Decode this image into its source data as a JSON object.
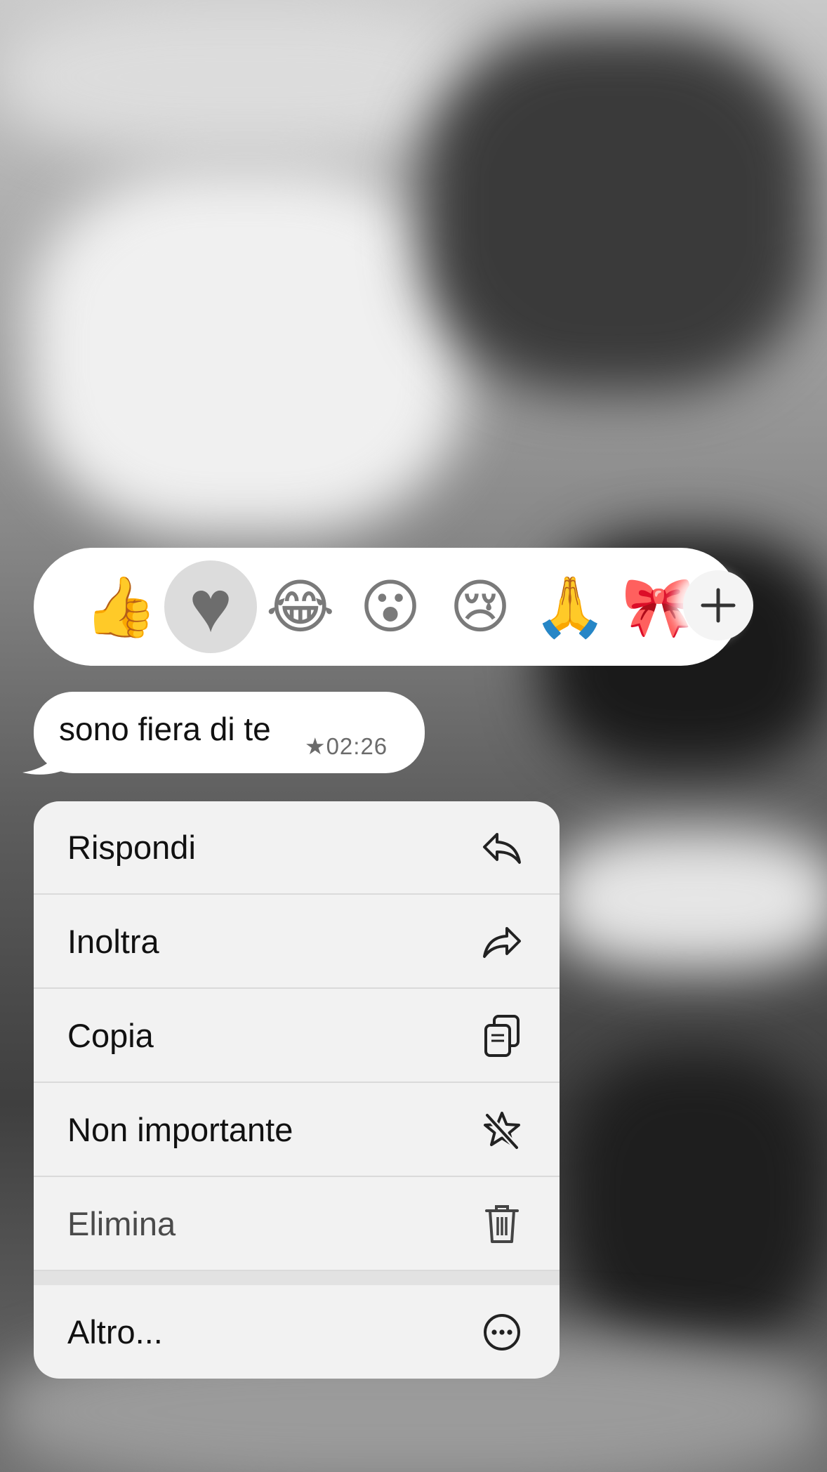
{
  "reaction_bar": {
    "reactions": [
      {
        "icon": "thumbs-up-emoji",
        "glyph": "👍"
      },
      {
        "icon": "heart-emoji",
        "glyph": "♥",
        "selected": true
      },
      {
        "icon": "tears-of-joy-emoji",
        "glyph": "😂"
      },
      {
        "icon": "surprised-face-emoji",
        "glyph": "😮"
      },
      {
        "icon": "crying-face-emoji",
        "glyph": "😢"
      },
      {
        "icon": "folded-hands-emoji",
        "glyph": "🙏"
      },
      {
        "icon": "ribbon-emoji",
        "glyph": "🎀"
      }
    ],
    "more_icon": "plus-icon"
  },
  "message": {
    "text": "sono fiera di te",
    "starred_icon": "star-icon",
    "time": "★02:26"
  },
  "context_menu": {
    "items": [
      {
        "label": "Rispondi",
        "icon": "reply-icon"
      },
      {
        "label": "Inoltra",
        "icon": "forward-icon"
      },
      {
        "label": "Copia",
        "icon": "copy-icon"
      },
      {
        "label": "Non importante",
        "icon": "unstar-icon"
      },
      {
        "label": "Elimina",
        "icon": "trash-icon"
      }
    ],
    "more": {
      "label": "Altro...",
      "icon": "more-icon"
    }
  },
  "colors": {
    "menu_background": "#f2f2f2",
    "bubble_background": "#ffffff",
    "text": "#111111",
    "meta_text": "#6b6b6b"
  }
}
